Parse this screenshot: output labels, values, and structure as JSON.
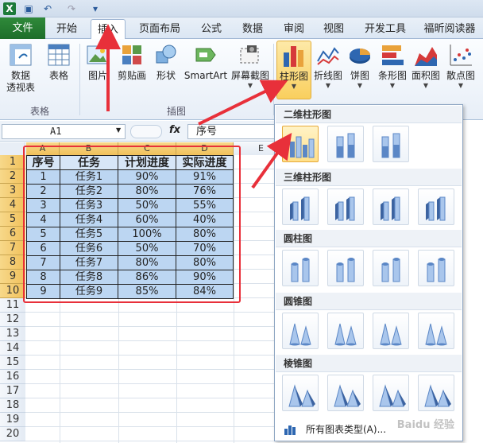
{
  "qat": {
    "icons": [
      "excel-logo-icon",
      "save-icon",
      "undo-icon",
      "redo-icon",
      "customize-icon"
    ]
  },
  "tabs": [
    "文件",
    "开始",
    "插入",
    "页面布局",
    "公式",
    "数据",
    "审阅",
    "视图",
    "开发工具",
    "福昕阅读器"
  ],
  "active_tab": "插入",
  "ribbon": {
    "pivot_label": "数据\n透视表",
    "table_label": "表格",
    "picture_label": "图片",
    "clipart_label": "剪贴画",
    "shapes_label": "形状",
    "smartart_label": "SmartArt",
    "screenshot_label": "屏幕截图",
    "column_label": "柱形图",
    "line_label": "折线图",
    "pie_label": "饼图",
    "bar_label": "条形图",
    "area_label": "面积图",
    "scatter_label": "散点图",
    "group_tables": "表格",
    "group_illustrations": "插图"
  },
  "formula_bar": {
    "name_box": "A1",
    "fx": "fx",
    "value": "序号"
  },
  "sheet": {
    "columns": [
      "A",
      "B",
      "C",
      "D",
      "E"
    ],
    "rows": [
      "1",
      "2",
      "3",
      "4",
      "5",
      "6",
      "7",
      "8",
      "9",
      "10",
      "11",
      "12",
      "13",
      "14",
      "15",
      "16",
      "17",
      "18",
      "19",
      "20"
    ],
    "headers": [
      "序号",
      "任务",
      "计划进度",
      "实际进度"
    ],
    "data": [
      [
        "1",
        "任务1",
        "90%",
        "91%"
      ],
      [
        "2",
        "任务2",
        "80%",
        "76%"
      ],
      [
        "3",
        "任务3",
        "50%",
        "55%"
      ],
      [
        "4",
        "任务4",
        "60%",
        "40%"
      ],
      [
        "5",
        "任务5",
        "100%",
        "80%"
      ],
      [
        "6",
        "任务6",
        "50%",
        "70%"
      ],
      [
        "7",
        "任务7",
        "80%",
        "80%"
      ],
      [
        "8",
        "任务8",
        "86%",
        "90%"
      ],
      [
        "9",
        "任务9",
        "85%",
        "84%"
      ]
    ]
  },
  "gallery": {
    "sections": [
      "二维柱形图",
      "三维柱形图",
      "圆柱图",
      "圆锥图",
      "棱锥图"
    ],
    "footer": "所有图表类型(A)...",
    "watermark": "Baidu 经验"
  },
  "colors": {
    "file_tab": "#1e6e2a",
    "selection": "#bcd6f2",
    "highlight_box": "#e8303a",
    "arrow": "#e8303a"
  }
}
